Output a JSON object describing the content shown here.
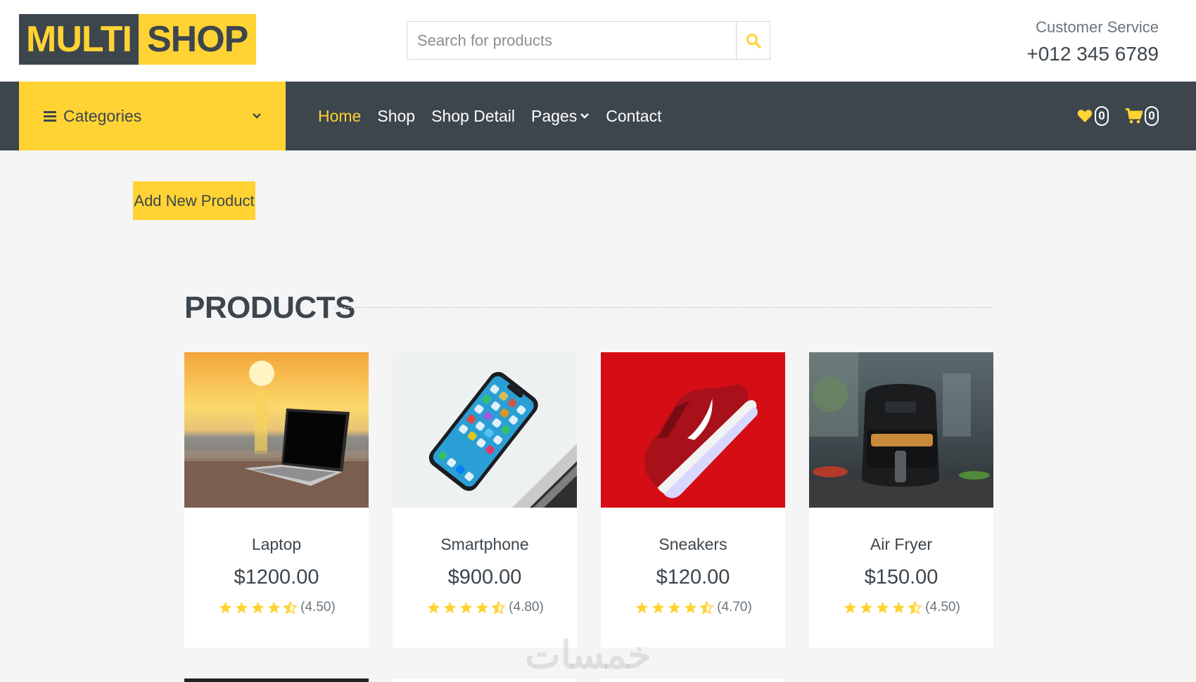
{
  "header": {
    "logo_left": "MULTI",
    "logo_right": "SHOP",
    "search_placeholder": "Search for products",
    "customer_service_label": "Customer Service",
    "customer_service_phone": "+012 345 6789"
  },
  "nav": {
    "categories_label": "Categories",
    "links": [
      {
        "label": "Home",
        "active": true
      },
      {
        "label": "Shop",
        "active": false
      },
      {
        "label": "Shop Detail",
        "active": false
      },
      {
        "label": "Pages",
        "active": false,
        "dropdown": true
      },
      {
        "label": "Contact",
        "active": false
      }
    ],
    "wishlist_count": "0",
    "cart_count": "0"
  },
  "actions": {
    "add_product_label": "Add New Product"
  },
  "section": {
    "title": "PRODUCTS"
  },
  "products": [
    {
      "name": "Laptop",
      "price": "$1200.00",
      "rating": 4.5,
      "rating_label": "(4.50)",
      "image": "laptop-on-beach-sunset"
    },
    {
      "name": "Smartphone",
      "price": "$900.00",
      "rating": 4.8,
      "rating_label": "(4.80)",
      "image": "smartphone-on-laptop"
    },
    {
      "name": "Sneakers",
      "price": "$120.00",
      "rating": 4.7,
      "rating_label": "(4.70)",
      "image": "red-sneaker"
    },
    {
      "name": "Air Fryer",
      "price": "$150.00",
      "rating": 4.5,
      "rating_label": "(4.50)",
      "image": "air-fryer-kitchen"
    }
  ],
  "watermark": "خمسات",
  "colors": {
    "primary": "#ffd333",
    "dark": "#3d464d",
    "background": "#f5f5f5",
    "star": "#ffd333"
  }
}
